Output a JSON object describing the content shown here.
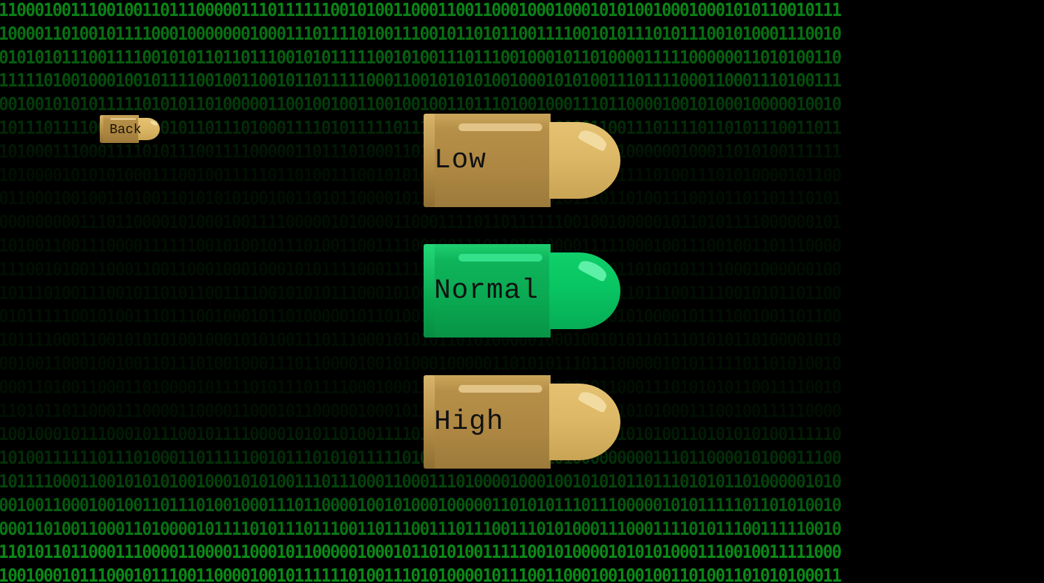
{
  "background": {
    "binary_rows": [
      "1100010011100100110111000001110111111001010011000110011000100010001010100100010001010110010111",
      "1000011010010111100010000000100011101111010011100101101011001111001010111010111001010001110010",
      "0101010111001111001010110110111001010111110010100111011100100010110100001111100000011010100110",
      "1111101001000100101111001001100101101111100011001010101001000101010011101111000110001110100111",
      "0010010101011111010101101000001100100100110010010011011101001000111011000010010100010000010010",
      "1011101111000011010101101110100011110101111101110100100000110100001100111011110110101110011011",
      "1010001110001111010111001111000001101110100011011101011100001100010111000000100011010100111111",
      "1010000101010100011100100111110110100111001010101110111110000100101111111010011101010000101100",
      "0110001001001101001101010101001001101011000010111101010111110010111011010011100101101101110101",
      "0000000001110110000101000100111100000101000011000111101101111110010010000010110101111000000101",
      "1010011001110000111111001010010111010011001111001001110110101000011111000100111001001101110000",
      "1110010100110001100110001000100010101111000111110001101110110010100001101001011110001000000100",
      "1011101001110010110101100111100101010111000101001110010111110110010101101110011110010101101100",
      "0101111100101001110111001000101101000001011010011100100001111111110101010000101111001001101100",
      "1011110001100101010100100010101001110111000101010110101000001000100101011011101010110100001010",
      "0010011000100100110111010010001110110000100101000100000110101011101110000010101111101101010010",
      "0001101001100011010000101111010111011110001000110101111111111010110110001110101010110011110010",
      "1101011011000111000011000011000101100000100010110101001011100101000101010100011100100111110000",
      "1001000101110001011100101111000010101101001111010100100101111101000111010100110101010100111110",
      "1010011111101110100011011111001011101010111110101010111110100101000000000111011000010100011100",
      "1011110001100101010100100010101001110111000110001110100001000100101010110111010101101000001010",
      "0010011000100100110111010010001110110000100101000100000110101011101110000010101111101101010010",
      "0001101001100011010000101111010111011100110111001110111001110101000111000111101011100111110010",
      "1101011011000111000011000011000101100000100010110101001111100101000010101010001110010011111000",
      "1001000101110001011100110000100101111110100111010100001011100110001001001001101001101010100011"
    ]
  },
  "back_button": {
    "label": "Back"
  },
  "options": [
    {
      "id": "low",
      "label": "Low",
      "selected": false
    },
    {
      "id": "normal",
      "label": "Normal",
      "selected": true
    },
    {
      "id": "high",
      "label": "High",
      "selected": false
    }
  ],
  "colors": {
    "binary_text": "#0a8a17",
    "selected_bullet": "#0bbf5e",
    "unselected_bullet": "#b48c45"
  }
}
